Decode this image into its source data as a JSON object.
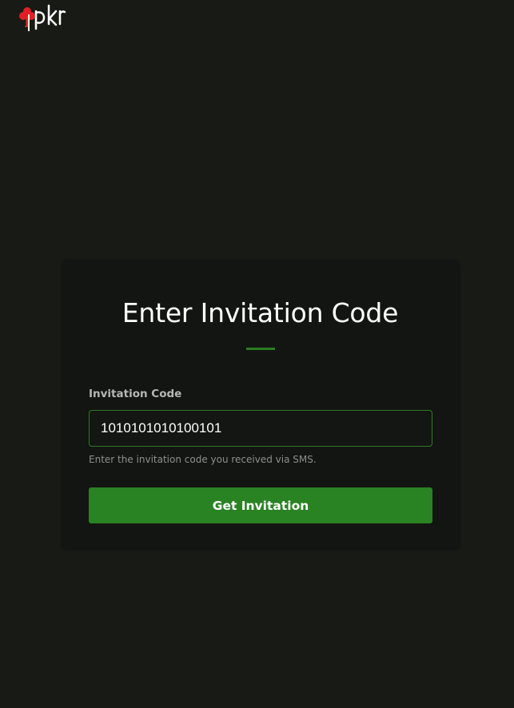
{
  "brand": {
    "logo_text": "pkr",
    "logo_icon": "club-suit-icon",
    "colors": {
      "club": "#df1f26",
      "letters": "#ffffff",
      "divider": "#fff8dc"
    }
  },
  "card": {
    "title": "Enter Invitation Code",
    "field_label": "Invitation Code",
    "input_value": "1010101010100101",
    "help_text": "Enter the invitation code you received via SMS.",
    "button_label": "Get Invitation"
  },
  "colors": {
    "page_background": "#171a15",
    "card_background": "#131512",
    "accent": "#2a8323",
    "input_border": "#2f7a24"
  }
}
